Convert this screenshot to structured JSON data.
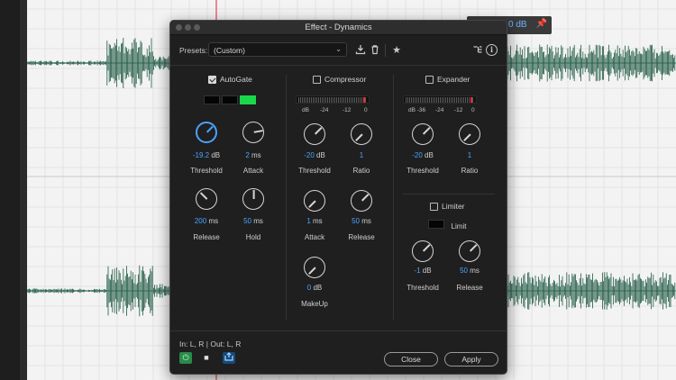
{
  "dialog": {
    "title": "Effect - Dynamics",
    "presets_label": "Presets:",
    "preset_value": "(Custom)",
    "footer_io": "In: L, R | Out: L, R",
    "close_label": "Close",
    "apply_label": "Apply"
  },
  "background": {
    "level_readout": "0 dB"
  },
  "autogate": {
    "label": "AutoGate",
    "enabled": true,
    "threshold": {
      "value": "-19.2",
      "unit": "dB",
      "label": "Threshold"
    },
    "attack": {
      "value": "2",
      "unit": "ms",
      "label": "Attack"
    },
    "release": {
      "value": "200",
      "unit": "ms",
      "label": "Release"
    },
    "hold": {
      "value": "50",
      "unit": "ms",
      "label": "Hold"
    }
  },
  "compressor": {
    "label": "Compressor",
    "enabled": false,
    "scale": [
      "dB",
      "-24",
      "-12",
      "0"
    ],
    "threshold": {
      "value": "-20",
      "unit": "dB",
      "label": "Threshold"
    },
    "ratio": {
      "value": "1",
      "unit": "",
      "label": "Ratio"
    },
    "attack": {
      "value": "1",
      "unit": "ms",
      "label": "Attack"
    },
    "release": {
      "value": "50",
      "unit": "ms",
      "label": "Release"
    },
    "makeup": {
      "value": "0",
      "unit": "dB",
      "label": "MakeUp"
    }
  },
  "expander": {
    "label": "Expander",
    "enabled": false,
    "scale": [
      "dB -36",
      "-24",
      "-12",
      "0"
    ],
    "threshold": {
      "value": "-20",
      "unit": "dB",
      "label": "Threshold"
    },
    "ratio": {
      "value": "1",
      "unit": "",
      "label": "Ratio"
    }
  },
  "limiter": {
    "label": "Limiter",
    "enabled": false,
    "limit_label": "Limit",
    "threshold": {
      "value": "-1",
      "unit": "dB",
      "label": "Threshold"
    },
    "release": {
      "value": "50",
      "unit": "ms",
      "label": "Release"
    }
  },
  "colors": {
    "accent": "#4aa3ff",
    "gate_active": "#1bd84a",
    "meter_peak": "#ff2b2b",
    "waveform": "#1f5a44"
  },
  "icons": {
    "save_preset": "download-icon",
    "delete_preset": "trash-icon",
    "favorite": "star-icon",
    "routing": "routing-icon",
    "info": "info-icon",
    "power": "power-icon",
    "stop": "stop-icon",
    "apply_mode": "apply-to-track-icon",
    "pin": "pin-icon"
  }
}
